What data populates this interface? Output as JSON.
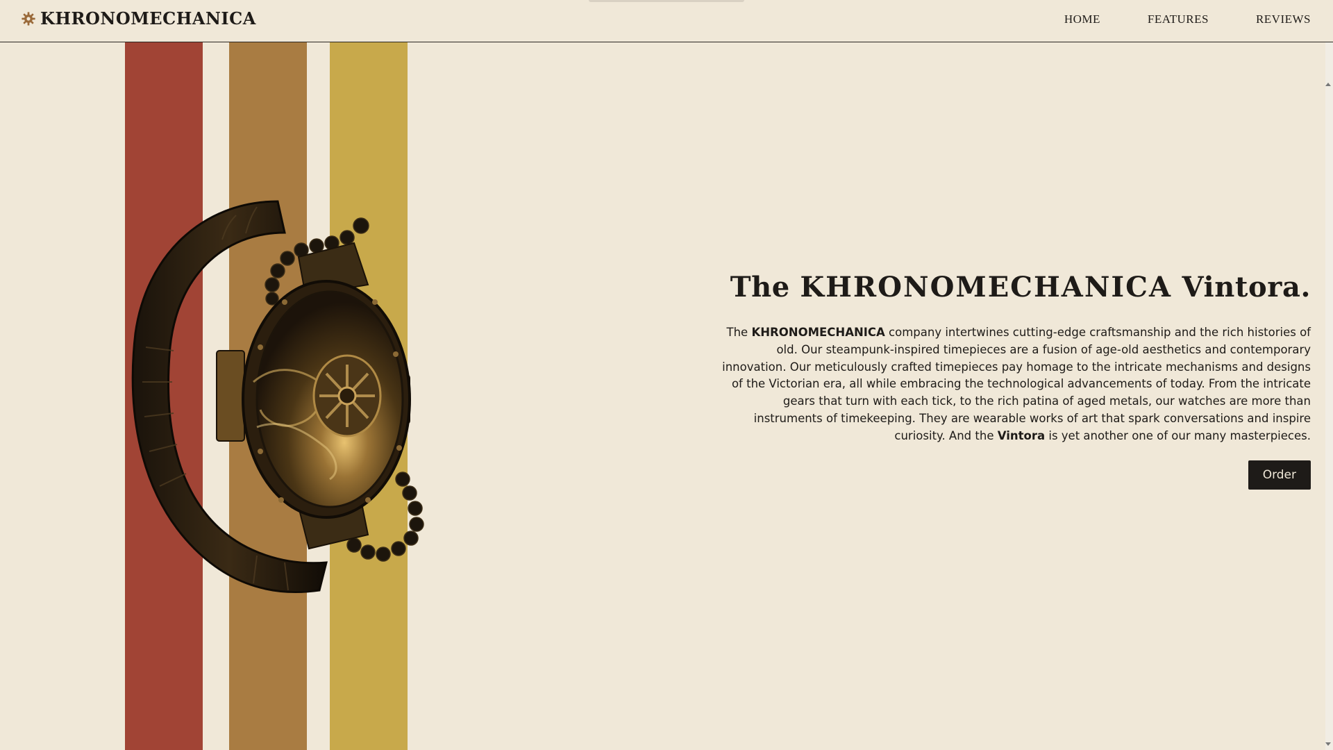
{
  "brand": {
    "name": "KHRONOMECHANICA",
    "icon": "gear-icon"
  },
  "nav": {
    "links": [
      "HOME",
      "FEATURES",
      "REVIEWS"
    ]
  },
  "hero": {
    "title_prefix": "The ",
    "title_highlight": "KHRONOMECHANICA",
    "title_suffix": " Vintora.",
    "desc_part1": "The ",
    "desc_bold1": "KHRONOMECHANICA",
    "desc_part2": " company intertwines cutting-edge craftsmanship and the rich histories of old. Our steampunk-inspired timepieces are a fusion of age-old aesthetics and contemporary innovation. Our meticulously crafted timepieces pay homage to the intricate mechanisms and designs of the Victorian era, all while embracing the technological advancements of today. From the intricate gears that turn with each tick, to the rich patina of aged metals, our watches are more than instruments of timekeeping. They are wearable works of art that spark conversations and inspire curiosity. And the ",
    "desc_bold2": "Vintora",
    "desc_part3": " is yet another one of our many masterpieces.",
    "order_label": "Order"
  },
  "colors": {
    "background": "#f0e8d8",
    "text": "#1e1b18",
    "stripe_red": "#a14435",
    "stripe_bronze": "#a97c42",
    "stripe_gold": "#c8a94b"
  }
}
